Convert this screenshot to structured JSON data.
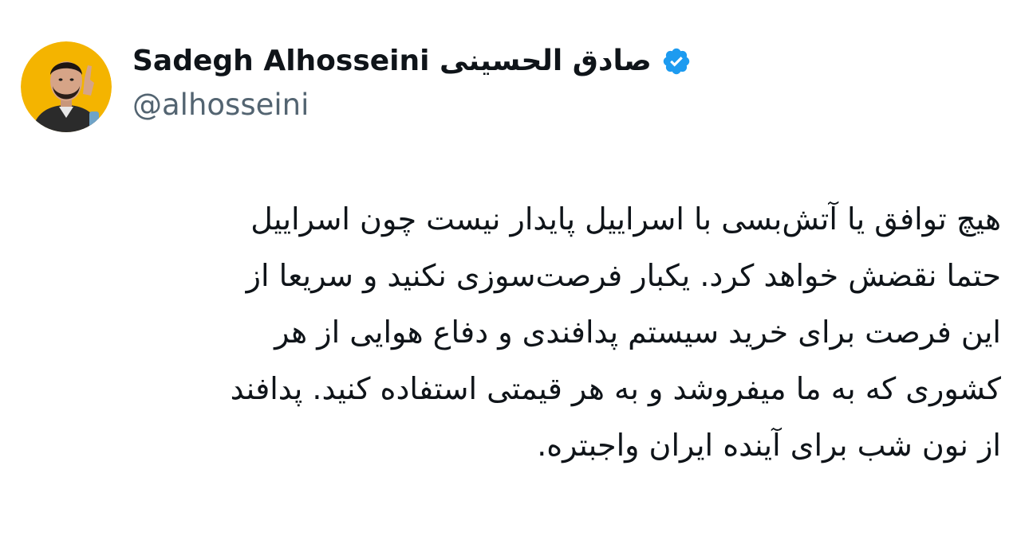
{
  "author": {
    "display_name": "Sadegh Alhosseini صادق الحسینی",
    "handle": "@alhosseini",
    "verified_icon": "verified-badge-icon",
    "verified_color": "#1d9bf0",
    "avatar_bg": "#f4b400"
  },
  "tweet": {
    "text": "هیچ توافق یا آتش‌بسی با اسراییل پایدار نیست چون اسراییل\nحتما نقضش خواهد کرد. یکبار فرصت‌سوزی نکنید و سریعا از\nاین فرصت برای خرید سیستم پدافندی و دفاع هوایی از هر\nکشوری که به ما میفروشد و به هر قیمتی استفاده کنید. پدافند\nاز نون شب برای آینده ایران واجبتره."
  },
  "colors": {
    "text_primary": "#0f1419",
    "text_secondary": "#536471",
    "background": "#ffffff"
  }
}
